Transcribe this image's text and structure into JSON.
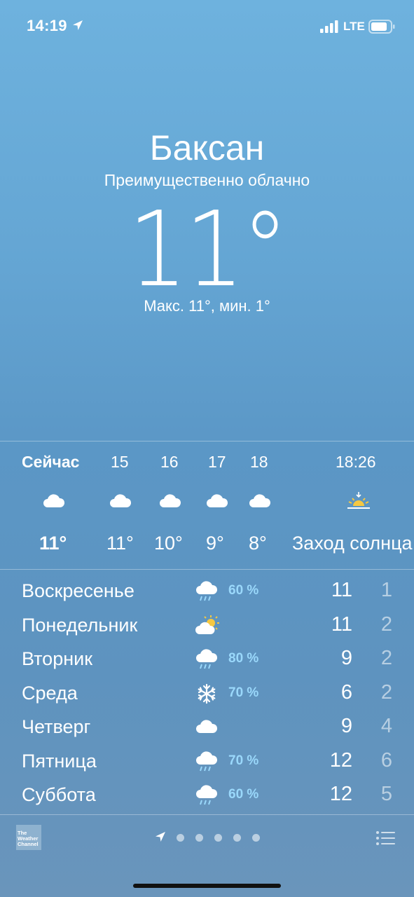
{
  "status_bar": {
    "time": "14:19",
    "network": "LTE",
    "icons": [
      "location-arrow-icon",
      "signal-icon",
      "battery-icon"
    ]
  },
  "current": {
    "city": "Баксан",
    "condition": "Преимущественно облачно",
    "temperature": "11°",
    "hilo": "Макс. 11°, мин. 1°"
  },
  "hourly": [
    {
      "label": "Сейчас",
      "icon": "cloud-icon",
      "temp": "11°",
      "bold": true
    },
    {
      "label": "15",
      "icon": "cloud-icon",
      "temp": "11°"
    },
    {
      "label": "16",
      "icon": "cloud-icon",
      "temp": "10°"
    },
    {
      "label": "17",
      "icon": "cloud-icon",
      "temp": "9°"
    },
    {
      "label": "18",
      "icon": "cloud-icon",
      "temp": "8°"
    },
    {
      "label": "18:26",
      "icon": "sunset-icon",
      "temp": "Заход солнца"
    }
  ],
  "daily": [
    {
      "day": "Воскресенье",
      "icon": "cloud-rain-icon",
      "precip": "60 %",
      "high": "11",
      "low": "1"
    },
    {
      "day": "Понедельник",
      "icon": "partly-sunny-icon",
      "precip": "",
      "high": "11",
      "low": "2"
    },
    {
      "day": "Вторник",
      "icon": "cloud-rain-icon",
      "precip": "80 %",
      "high": "9",
      "low": "2"
    },
    {
      "day": "Среда",
      "icon": "snowflake-icon",
      "precip": "70 %",
      "high": "6",
      "low": "2"
    },
    {
      "day": "Четверг",
      "icon": "cloud-icon",
      "precip": "",
      "high": "9",
      "low": "4"
    },
    {
      "day": "Пятница",
      "icon": "cloud-rain-icon",
      "precip": "70 %",
      "high": "12",
      "low": "6"
    },
    {
      "day": "Суббота",
      "icon": "cloud-rain-icon",
      "precip": "60 %",
      "high": "12",
      "low": "5"
    }
  ],
  "footer": {
    "logo_text": "The Weather Channel",
    "page_count": 5,
    "icons": [
      "weather-channel-logo",
      "location-page-icon",
      "list-icon"
    ]
  },
  "colors": {
    "precip": "#9ad8fb",
    "sun": "#f5c842"
  }
}
